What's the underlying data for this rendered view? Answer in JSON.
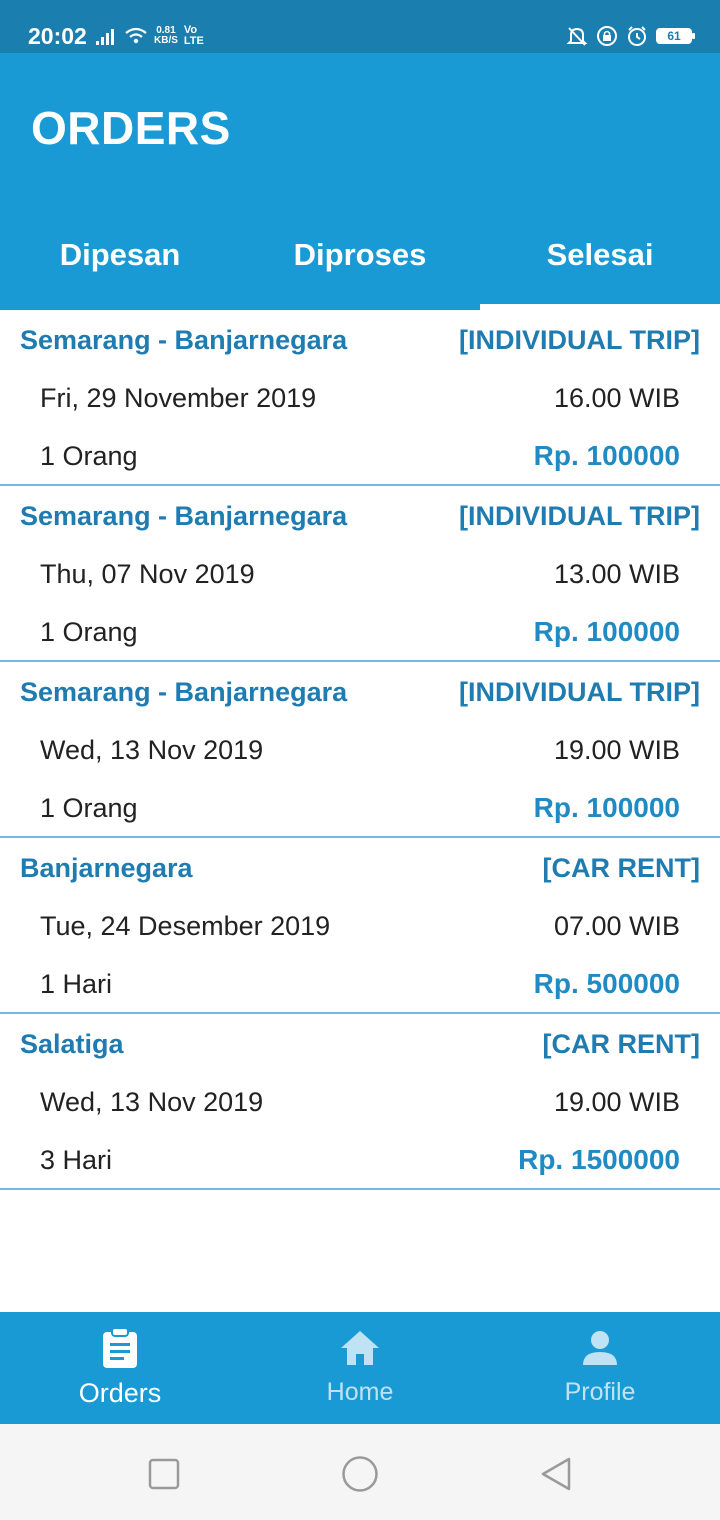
{
  "status_bar": {
    "time": "20:02",
    "speed_value": "0.81",
    "speed_unit": "KB/S",
    "net_top": "Vo",
    "net_bottom": "LTE",
    "battery": "61"
  },
  "header": {
    "title": "ORDERS"
  },
  "tabs": [
    {
      "label": "Dipesan",
      "active": false
    },
    {
      "label": "Diproses",
      "active": false
    },
    {
      "label": "Selesai",
      "active": true
    }
  ],
  "orders": [
    {
      "route": "Semarang - Banjarnegara",
      "type": "[INDIVIDUAL TRIP]",
      "date": "Fri, 29 November 2019",
      "time": "16.00 WIB",
      "qty": "1 Orang",
      "price": "Rp. 100000"
    },
    {
      "route": "Semarang - Banjarnegara",
      "type": "[INDIVIDUAL TRIP]",
      "date": "Thu, 07 Nov 2019",
      "time": "13.00 WIB",
      "qty": "1 Orang",
      "price": "Rp. 100000"
    },
    {
      "route": "Semarang - Banjarnegara",
      "type": "[INDIVIDUAL TRIP]",
      "date": "Wed, 13 Nov 2019",
      "time": "19.00 WIB",
      "qty": "1 Orang",
      "price": "Rp. 100000"
    },
    {
      "route": "Banjarnegara",
      "type": "[CAR RENT]",
      "date": "Tue, 24 Desember 2019",
      "time": "07.00 WIB",
      "qty": "1 Hari",
      "price": "Rp. 500000"
    },
    {
      "route": "Salatiga",
      "type": "[CAR RENT]",
      "date": "Wed, 13 Nov 2019",
      "time": "19.00 WIB",
      "qty": "3 Hari",
      "price": "Rp. 1500000"
    }
  ],
  "bottom_nav": [
    {
      "label": "Orders",
      "icon": "clipboard-icon",
      "active": true
    },
    {
      "label": "Home",
      "icon": "home-icon",
      "active": false
    },
    {
      "label": "Profile",
      "icon": "person-icon",
      "active": false
    }
  ],
  "colors": {
    "app_bar": "#1a9ad4",
    "status_bar": "#1a7fae",
    "accent_text": "#1f7cb0",
    "divider": "#6fb8e8"
  }
}
